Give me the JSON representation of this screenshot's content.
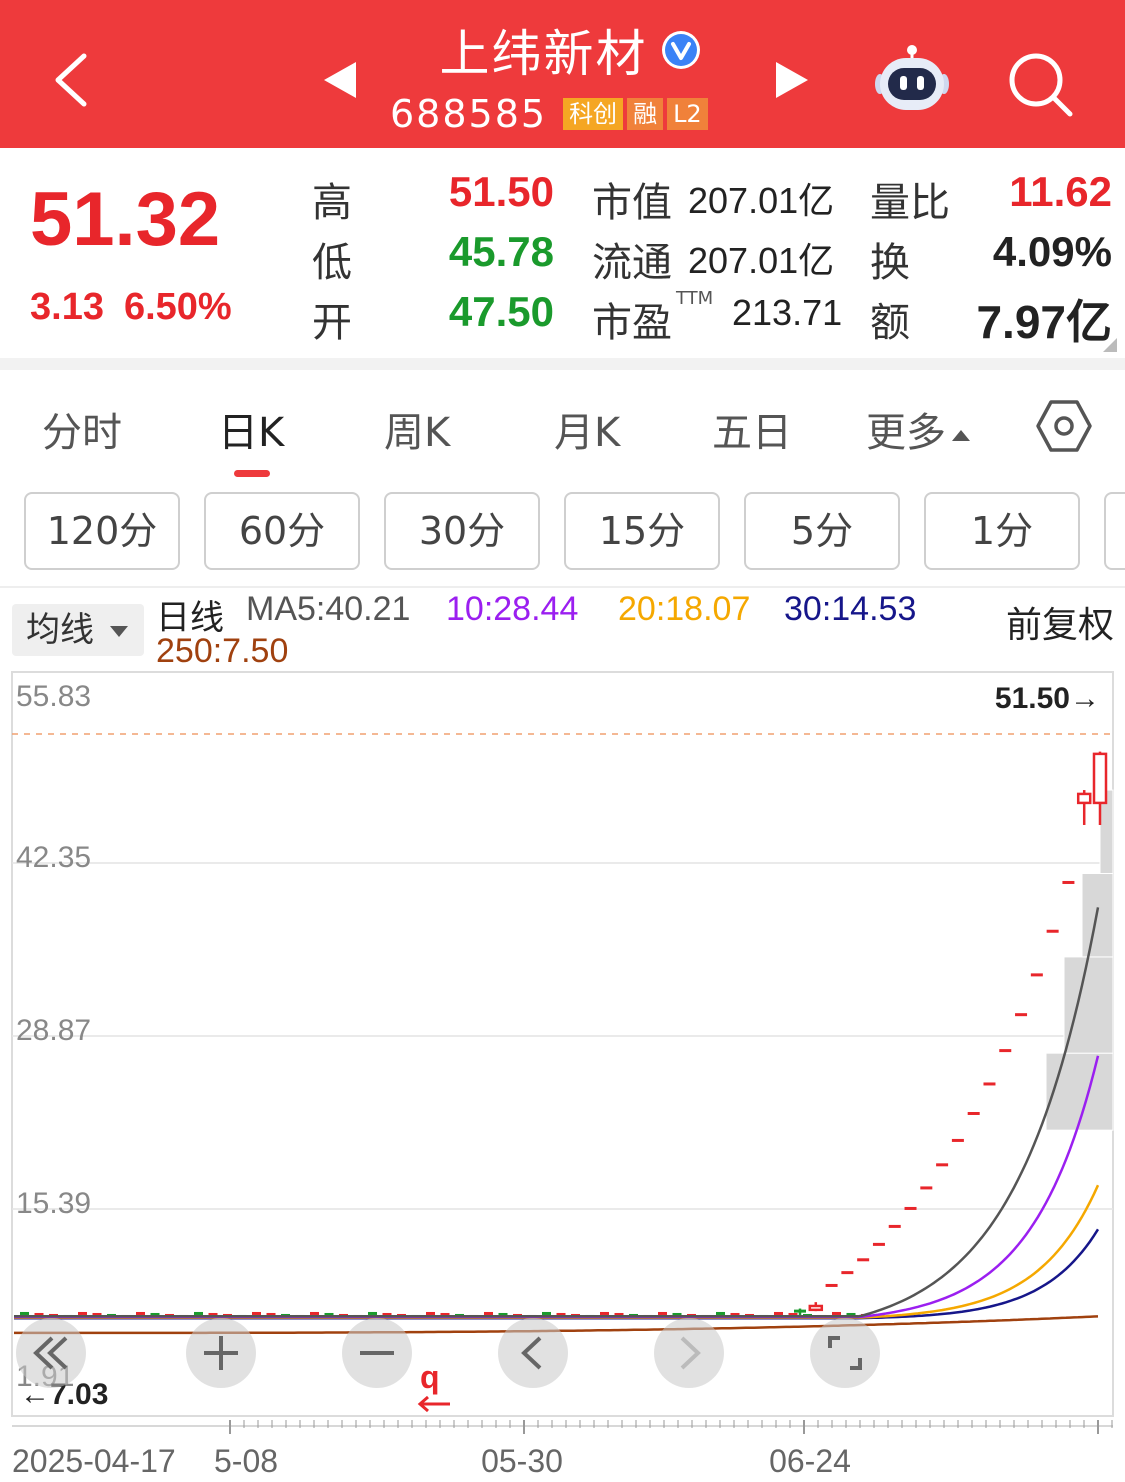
{
  "header": {
    "stock_name": "上纬新材",
    "stock_code": "688585",
    "badges": [
      "科创",
      "融",
      "L2"
    ],
    "icons": [
      "back-arrow-icon",
      "prev-triangle-icon",
      "verified-icon",
      "next-triangle-icon",
      "robot-assistant-icon",
      "search-icon"
    ]
  },
  "quote": {
    "price": "51.32",
    "change": "3.13",
    "change_pct": "6.50%",
    "high_label": "高",
    "high": "51.50",
    "low_label": "低",
    "low": "45.78",
    "open_label": "开",
    "open": "47.50",
    "mcap_label": "市值",
    "mcap": "207.01亿",
    "float_label": "流通",
    "float": "207.01亿",
    "pe_label": "市盈",
    "pe_sup": "TTM",
    "pe": "213.71",
    "vol_ratio_label": "量比",
    "vol_ratio": "11.62",
    "turnover_label": "换",
    "turnover": "4.09%",
    "amount_label": "额",
    "amount": "7.97亿"
  },
  "tabs": {
    "items": [
      "分时",
      "日K",
      "周K",
      "月K",
      "五日",
      "更多"
    ],
    "active": "日K"
  },
  "minute_buttons": [
    "120分",
    "60分",
    "30分",
    "15分",
    "5分",
    "1分"
  ],
  "ma_legend": {
    "select_label": "均线",
    "title": "日线",
    "ma5": "MA5:40.21",
    "ma10": "10:28.44",
    "ma20": "20:18.07",
    "ma30": "30:14.53",
    "ma250": "250:7.50",
    "adjust": "前复权",
    "colors": {
      "ma5": "#555555",
      "ma10": "#9b1ff0",
      "ma20": "#f5a800",
      "ma30": "#16168a",
      "ma250": "#a0410f"
    }
  },
  "chart_data": {
    "type": "candlestick",
    "y_axis_labels": [
      "55.83",
      "42.35",
      "28.87",
      "15.39",
      "1.91"
    ],
    "ylim": [
      1.91,
      55.83
    ],
    "x_axis_labels": [
      "2025-04-17",
      "5-08",
      "05-30",
      "06-24"
    ],
    "max_marker": "51.50→",
    "min_marker": "←7.03",
    "flat_close": 7.6,
    "recent_candles": [
      {
        "open": 7.9,
        "close": 7.8,
        "high": 8.1,
        "low": 7.6
      },
      {
        "open": 8.0,
        "close": 8.3,
        "high": 8.6,
        "low": 7.9
      },
      {
        "open": 9.9,
        "close": 9.9,
        "high": 9.9,
        "low": 9.9
      },
      {
        "open": 10.9,
        "close": 10.9,
        "high": 10.9,
        "low": 10.9
      },
      {
        "open": 11.9,
        "close": 11.9,
        "high": 11.9,
        "low": 11.9
      },
      {
        "open": 13.1,
        "close": 13.1,
        "high": 13.1,
        "low": 13.1
      },
      {
        "open": 14.5,
        "close": 14.5,
        "high": 14.5,
        "low": 14.5
      },
      {
        "open": 15.9,
        "close": 15.9,
        "high": 15.9,
        "low": 15.9
      },
      {
        "open": 17.5,
        "close": 17.5,
        "high": 17.5,
        "low": 17.5
      },
      {
        "open": 19.3,
        "close": 19.3,
        "high": 19.3,
        "low": 19.3
      },
      {
        "open": 21.2,
        "close": 21.2,
        "high": 21.2,
        "low": 21.2
      },
      {
        "open": 23.3,
        "close": 23.3,
        "high": 23.3,
        "low": 23.3
      },
      {
        "open": 25.6,
        "close": 25.6,
        "high": 25.6,
        "low": 25.6
      },
      {
        "open": 28.2,
        "close": 28.2,
        "high": 28.2,
        "low": 28.2
      },
      {
        "open": 31.0,
        "close": 31.0,
        "high": 31.0,
        "low": 31.0
      },
      {
        "open": 34.1,
        "close": 34.1,
        "high": 34.1,
        "low": 34.1
      },
      {
        "open": 37.5,
        "close": 37.5,
        "high": 37.5,
        "low": 37.5
      },
      {
        "open": 41.3,
        "close": 41.3,
        "high": 41.3,
        "low": 41.3
      },
      {
        "open": 47.5,
        "close": 48.2,
        "high": 48.5,
        "low": 45.78
      },
      {
        "open": 47.5,
        "close": 51.32,
        "high": 51.5,
        "low": 45.78
      }
    ],
    "volume_blocks": [
      {
        "top": 28.0,
        "bottom": 22.0
      },
      {
        "top": 35.5,
        "bottom": 28.0
      },
      {
        "top": 42.0,
        "bottom": 35.5
      },
      {
        "top": 48.5,
        "bottom": 42.0
      }
    ],
    "ma_end_values": {
      "ma5": 40.21,
      "ma10": 28.44,
      "ma20": 18.07,
      "ma30": 14.53,
      "ma250": 7.5
    }
  },
  "controls": [
    "scroll-left-icon",
    "zoom-in-icon",
    "zoom-out-icon",
    "pan-left-icon",
    "pan-right-icon",
    "fullscreen-icon"
  ]
}
